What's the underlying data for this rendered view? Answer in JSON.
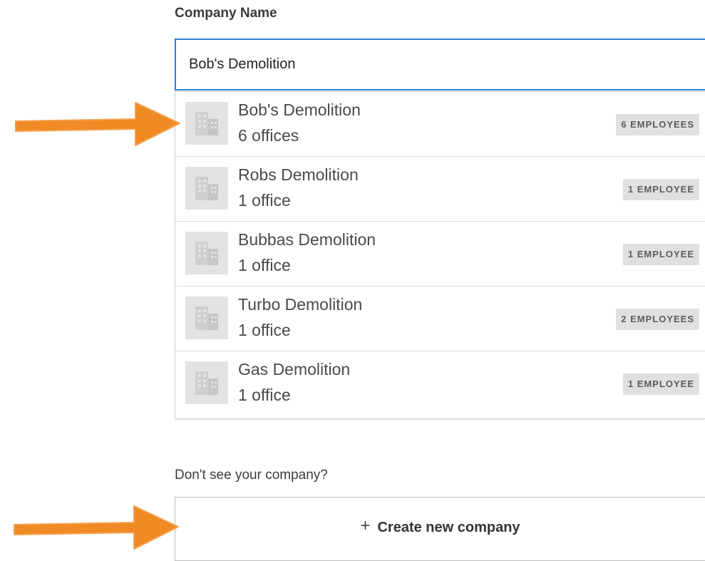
{
  "form": {
    "company_name_label": "Company Name",
    "company_name_value": "Bob's Demolition"
  },
  "results": [
    {
      "name": "Bob's Demolition",
      "offices": "6 offices",
      "employees": "6 EMPLOYEES"
    },
    {
      "name": "Robs Demolition",
      "offices": "1 office",
      "employees": "1 EMPLOYEE"
    },
    {
      "name": "Bubbas Demolition",
      "offices": "1 office",
      "employees": "1 EMPLOYEE"
    },
    {
      "name": "Turbo Demolition",
      "offices": "1 office",
      "employees": "2 EMPLOYEES"
    },
    {
      "name": "Gas Demolition",
      "offices": "1 office",
      "employees": "1 EMPLOYEE"
    }
  ],
  "create": {
    "prompt": "Don't see your company?",
    "plus_symbol": "+",
    "button_label": "Create new company"
  },
  "icons": {
    "company": "building-icon",
    "annotation": "arrow-annotation-icon"
  },
  "colors": {
    "focus_border": "#2d7ec9",
    "badge_bg": "#e0e0e0",
    "icon_bg": "#e3e3e3",
    "annotation_arrow": "#f08a24"
  }
}
